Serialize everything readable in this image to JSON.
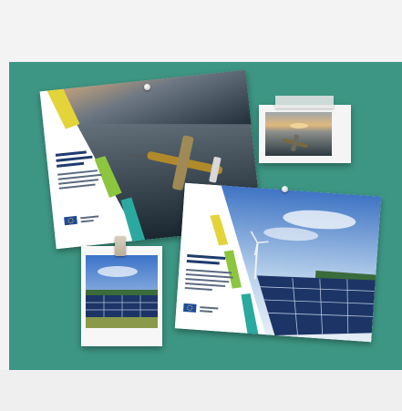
{
  "colors": {
    "board": "#3d9683",
    "background": "#f3f3f3",
    "accent_yellow": "#e3d43a",
    "accent_green": "#8cc63f",
    "accent_teal": "#2aa9a0",
    "eu_blue": "#1e4b9b"
  },
  "icons": [
    "push-pin-icon",
    "tape-icon",
    "binder-clip-icon",
    "eu-flag-icon"
  ]
}
